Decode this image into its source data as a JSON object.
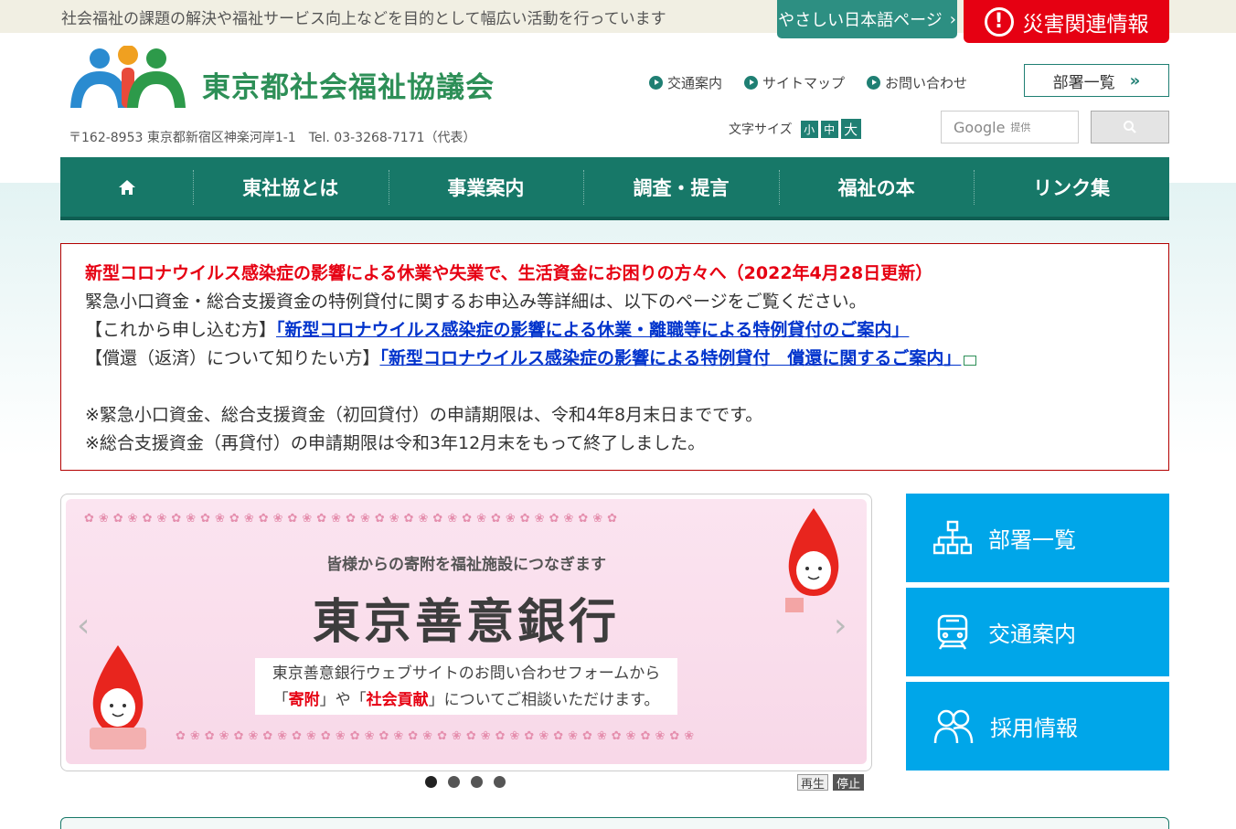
{
  "topbar": {
    "tagline": "社会福祉の課題の解決や福祉サービス向上などを目的として幅広い活動を行っています",
    "easy_japanese": "やさしい日本語ページ",
    "disaster_info": "災害関連情報"
  },
  "header": {
    "org_name": "東京都社会福祉協議会",
    "address": "〒162-8953 東京都新宿区神楽河岸1-1　Tel. 03-3268-7171（代表）",
    "util_links": [
      "交通案内",
      "サイトマップ",
      "お問い合わせ"
    ],
    "dept_list_button": "部署一覧",
    "font_size_label": "文字サイズ",
    "font_sizes": [
      "小",
      "中",
      "大"
    ],
    "search_placeholder_brand": "Google",
    "search_placeholder_sub": "提供"
  },
  "nav": {
    "items": [
      "東社協とは",
      "事業案内",
      "調査・提言",
      "福祉の本",
      "リンク集"
    ]
  },
  "notice": {
    "headline": "新型コロナウイルス感染症の影響による休業や失業で、生活資金にお困りの方々へ（2022年4月28日更新）",
    "line1": "緊急小口資金・総合支援資金の特例貸付に関するお申込み等詳細は、以下のページをご覧ください。",
    "apply_prefix": "【これから申し込む方】",
    "apply_link": "「新型コロナウイルス感染症の影響による休業・離職等による特例貸付のご案内」",
    "repay_prefix": "【償還（返済）について知りたい方】",
    "repay_link": "「新型コロナウイルス感染症の影響による特例貸付　償還に関するご案内」",
    "note1": "※緊急小口資金、総合支援資金（初回貸付）の申請期限は、令和4年8月末日までです。",
    "note2": "※総合支援資金（再貸付）の申請期限は令和3年12月末をもって終了しました。"
  },
  "slider": {
    "subtitle": "皆様からの寄附を福祉施設につなぎます",
    "title": "東京善意銀行",
    "box_line1": "東京善意銀行ウェブサイトのお問い合わせフォームから",
    "box_q1_open": "「",
    "box_kifu": "寄附",
    "box_mid": "」や「",
    "box_shakai": "社会貢献",
    "box_end": "」についてご相談いただけます。",
    "play": "再生",
    "stop": "停止",
    "slide_count": 4,
    "active_slide": 1
  },
  "side_buttons": [
    {
      "label": "部署一覧",
      "icon": "org-chart-icon"
    },
    {
      "label": "交通案内",
      "icon": "train-icon"
    },
    {
      "label": "採用情報",
      "icon": "people-icon"
    }
  ],
  "colors": {
    "nav_green": "#177868",
    "brand_green": "#2d8f57",
    "alert_red": "#e60012",
    "side_blue": "#00a6e9",
    "link_blue": "#0033cc"
  }
}
